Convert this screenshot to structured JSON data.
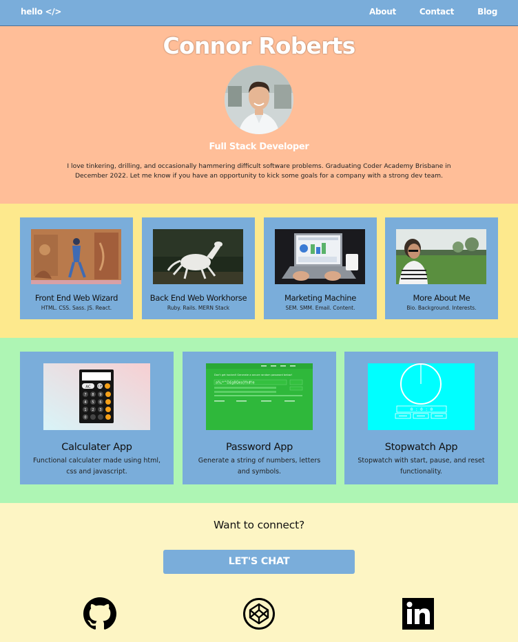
{
  "nav": {
    "logo": "hello </>",
    "links": [
      "About",
      "Contact",
      "Blog"
    ]
  },
  "hero": {
    "name": "Connor Roberts",
    "role": "Full Stack Developer",
    "bio": "I love tinkering, drilling, and occasionally hammering difficult software problems. Graduating Coder Academy Brisbane in December 2022. Let me know if you have an opportunity to kick some goals for a company with a strong dev team."
  },
  "services": [
    {
      "title": "Front End Web Wizard",
      "subtitle": "HTML. CSS. Sass. JS. React."
    },
    {
      "title": "Back End Web Workhorse",
      "subtitle": "Ruby. Rails. MERN Stack"
    },
    {
      "title": "Marketing Machine",
      "subtitle": "SEM. SMM. Email. Content."
    },
    {
      "title": "More About Me",
      "subtitle": "Bio. Background. Interests."
    }
  ],
  "projects": [
    {
      "title": "Calculater App",
      "description": "Functional calculater made using html, css and javascript.",
      "screenshot_text": {
        "clear": "AC",
        "ce": "CE",
        "digits": [
          "7",
          "8",
          "9",
          "4",
          "5",
          "6",
          "1",
          "2",
          "3",
          "0"
        ]
      }
    },
    {
      "title": "Password App",
      "description": "Generate a string of numbers, letters and symbols.",
      "screenshot_text": {
        "heading": "Don't get hacked! Generate a secure random password below!",
        "password": "a%;*^D£g8Qes(Yh#!e"
      }
    },
    {
      "title": "Stopwatch App",
      "description": "Stopwatch with start, pause, and reset functionality.",
      "screenshot_text": {
        "time": "0 : 0 : 0"
      }
    }
  ],
  "connect": {
    "title": "Want to connect?",
    "button": "LET'S CHAT",
    "social_icons": [
      "github-icon",
      "codepen-icon",
      "linkedin-icon"
    ]
  },
  "colors": {
    "nav": "#7aadda",
    "hero_bg": "#ffbe98",
    "services_bg": "#fde98d",
    "projects_bg": "#aef5b4",
    "connect_bg": "#fdf5c4",
    "card": "#7aadda"
  }
}
